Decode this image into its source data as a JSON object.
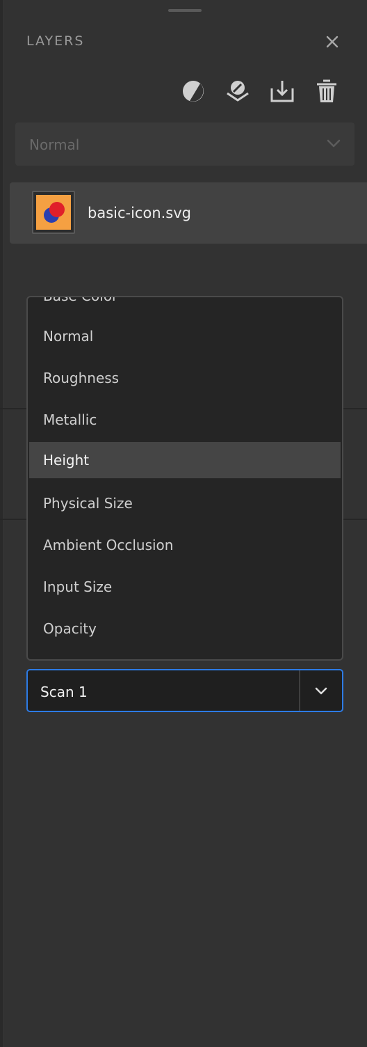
{
  "panel": {
    "title": "LAYERS"
  },
  "blend_select": {
    "value": "Normal"
  },
  "layer": {
    "name": "basic-icon.svg"
  },
  "channel_menu": {
    "partial_top_item": "Base Color",
    "items": [
      "Normal",
      "Roughness",
      "Metallic",
      "Height",
      "Physical Size",
      "Ambient Occlusion",
      "Input Size",
      "Opacity"
    ],
    "selected": "Height"
  },
  "source_combo": {
    "value": "Scan 1"
  },
  "colors": {
    "accent": "#2d7be5",
    "thumb_bg": "#f5a042",
    "thumb_dot_red": "#e01f2a",
    "thumb_dot_blue": "#2b3fb0"
  }
}
